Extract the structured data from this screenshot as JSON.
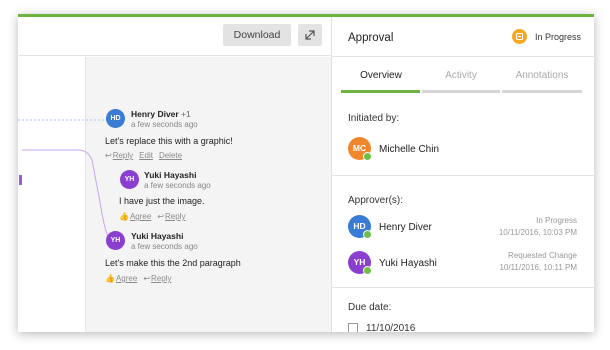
{
  "toolbar": {
    "download_label": "Download"
  },
  "comments": {
    "c1": {
      "initials": "HD",
      "author": "Henry Diver",
      "extra": "+1",
      "time": "a few seconds ago",
      "text": "Let's replace this with a graphic!",
      "actions": [
        "Reply",
        "Edit",
        "Delete"
      ]
    },
    "c2": {
      "initials": "YH",
      "author": "Yuki Hayashi",
      "time": "a few seconds ago",
      "text": "I have just the image.",
      "actions": [
        "Agree",
        "Reply"
      ]
    },
    "c3": {
      "initials": "YH",
      "author": "Yuki Hayashi",
      "time": "a few seconds ago",
      "text": "Let's make this the 2nd paragraph",
      "actions": [
        "Agree",
        "Reply"
      ]
    }
  },
  "panel": {
    "title": "Approval",
    "status": "In Progress",
    "tabs": [
      "Overview",
      "Activity",
      "Annotations"
    ],
    "initiated_label": "Initiated by:",
    "initiator": {
      "initials": "MC",
      "name": "Michelle Chin"
    },
    "approvers_label": "Approver(s):",
    "approvers": [
      {
        "initials": "HD",
        "name": "Henry Diver",
        "status": "In Progress",
        "date": "10/11/2016, 10:03 PM"
      },
      {
        "initials": "YH",
        "name": "Yuki Hayashi",
        "status": "Requested Change",
        "date": "10/11/2016, 10:11 PM"
      }
    ],
    "due_label": "Due date:",
    "due_date": "11/10/2016"
  },
  "colors": {
    "accent_green": "#6cb33f",
    "status_orange": "#f5a623",
    "hd_blue": "#3a7bd5",
    "yh_purple": "#8a3fd1",
    "mc_orange": "#f0872b"
  },
  "icons": [
    "expand-icon",
    "status-flag-icon",
    "thumbs-up-icon",
    "reply-arrow-icon",
    "calendar-icon"
  ]
}
